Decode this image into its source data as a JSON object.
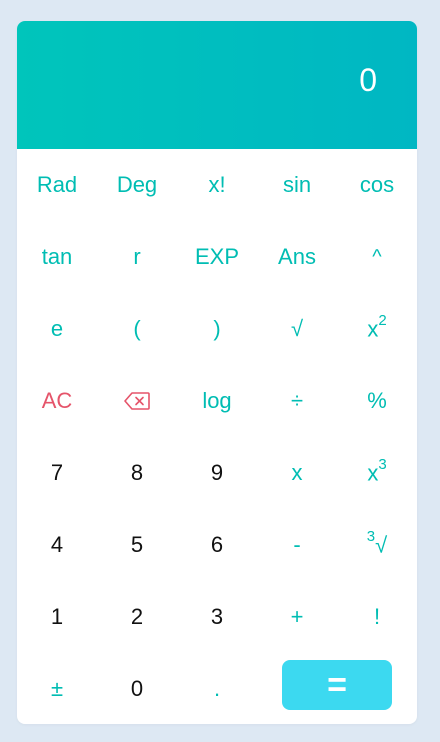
{
  "display": {
    "value": "0"
  },
  "colors": {
    "accent": "#00bdb3",
    "danger": "#e5546a",
    "equals_bg": "#3cd9f0",
    "display_from": "#00c5bb",
    "display_to": "#00b7c3"
  },
  "keys": {
    "rad": "Rad",
    "deg": "Deg",
    "factorial_fn": "x!",
    "sin": "sin",
    "cos": "cos",
    "tan": "tan",
    "r": "r",
    "exp": "EXP",
    "ans": "Ans",
    "power": "^",
    "e": "e",
    "lparen": "(",
    "rparen": ")",
    "sqrt": "√",
    "square_base": "x",
    "square_exp": "2",
    "ac": "AC",
    "backspace_icon": "backspace-icon",
    "log": "log",
    "divide": "÷",
    "percent": "%",
    "d7": "7",
    "d8": "8",
    "d9": "9",
    "multiply": "x",
    "cube_base": "x",
    "cube_exp": "3",
    "d4": "4",
    "d5": "5",
    "d6": "6",
    "minus": "-",
    "cbrt_index": "3",
    "cbrt_symbol": "√",
    "d1": "1",
    "d2": "2",
    "d3": "3",
    "plus": "+",
    "bang": "!",
    "plusminus": "±",
    "d0": "0",
    "dot": ".",
    "equals": "="
  }
}
